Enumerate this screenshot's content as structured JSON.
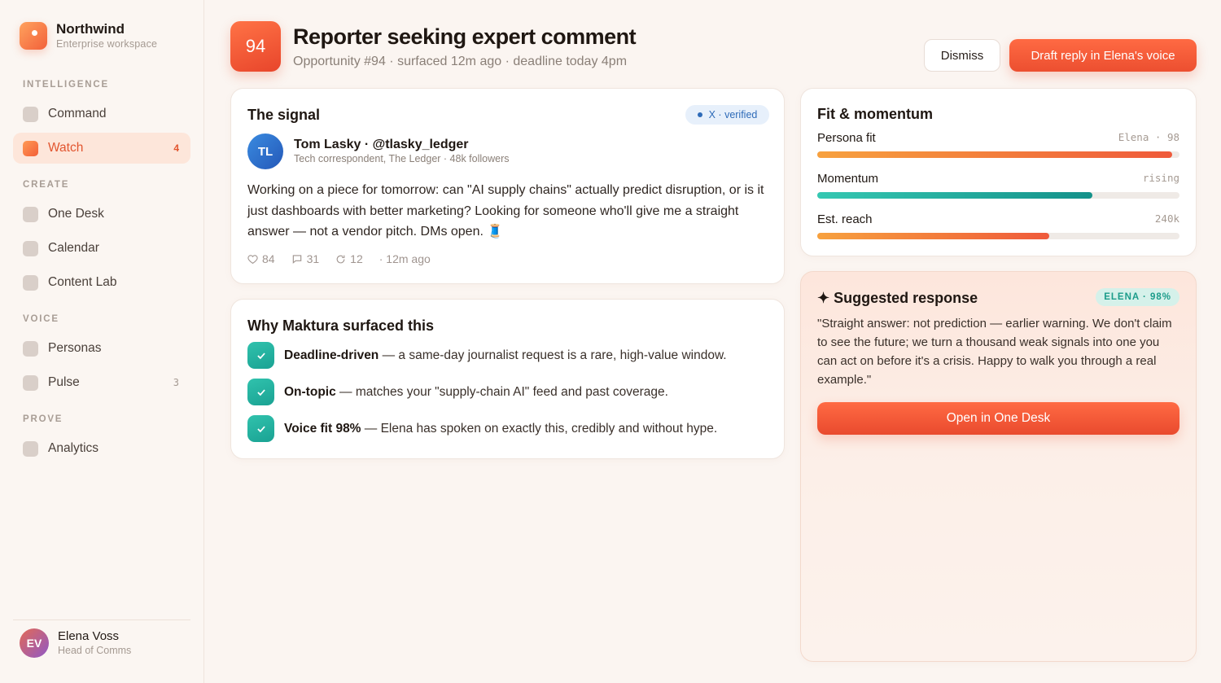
{
  "sidebar": {
    "brand_name": "Northwind",
    "brand_sub": "Enterprise workspace",
    "sections": {
      "intelligence": "INTELLIGENCE",
      "create": "CREATE",
      "voice": "VOICE",
      "prove": "PROVE"
    },
    "items": {
      "command": "Command",
      "watch": "Watch",
      "watch_badge": "4",
      "one_desk": "One Desk",
      "calendar": "Calendar",
      "content_lab": "Content Lab",
      "personas": "Personas",
      "pulse": "Pulse",
      "pulse_badge": "3",
      "analytics": "Analytics"
    },
    "user": {
      "initials": "EV",
      "name": "Elena Voss",
      "role": "Head of Comms"
    }
  },
  "header": {
    "score": "94",
    "title": "Reporter seeking expert comment",
    "meta": "Opportunity #94 · surfaced 12m ago · deadline today 4pm",
    "dismiss_label": "Dismiss",
    "draft_label": "Draft reply in Elena's voice"
  },
  "signal": {
    "title": "The signal",
    "verified": "X · verified",
    "author_initials": "TL",
    "author_name": "Tom Lasky · @tlasky_ledger",
    "author_sub": "Tech correspondent, The Ledger · 48k followers",
    "body": "Working on a piece for tomorrow: can \"AI supply chains\" actually predict disruption, or is it just dashboards with better marketing? Looking for someone who'll give me a straight answer — not a vendor pitch. DMs open. 🧵",
    "likes": "84",
    "comments": "31",
    "reposts": "12",
    "time": "· 12m ago"
  },
  "why": {
    "title": "Why Maktura surfaced this",
    "reasons": [
      {
        "bold": "Deadline-driven",
        "text": " — a same-day journalist request is a rare, high-value window."
      },
      {
        "bold": "On-topic",
        "text": " — matches your \"supply-chain AI\" feed and past coverage."
      },
      {
        "bold": "Voice fit 98%",
        "text": " — Elena has spoken on exactly this, credibly and without hype."
      }
    ]
  },
  "fit": {
    "title": "Fit & momentum",
    "metrics": [
      {
        "label": "Persona fit",
        "value": "Elena · 98",
        "level": 0.98
      },
      {
        "label": "Momentum",
        "value": "rising",
        "level": 0.76
      },
      {
        "label": "Est. reach",
        "value": "240k",
        "level": 0.64
      }
    ]
  },
  "suggest": {
    "title": "✦ Suggested response",
    "badge": "ELENA · 98%",
    "body": "\"Straight answer: not prediction — earlier warning. We don't claim to see the future; we turn a thousand weak signals into one you can act on before it's a crisis. Happy to walk you through a real example.\"",
    "open_label": "Open in One Desk"
  },
  "colors": {
    "accent": "#ef5a3b",
    "teal": "#1aa293",
    "verified_blue": "#2e6bb8"
  }
}
